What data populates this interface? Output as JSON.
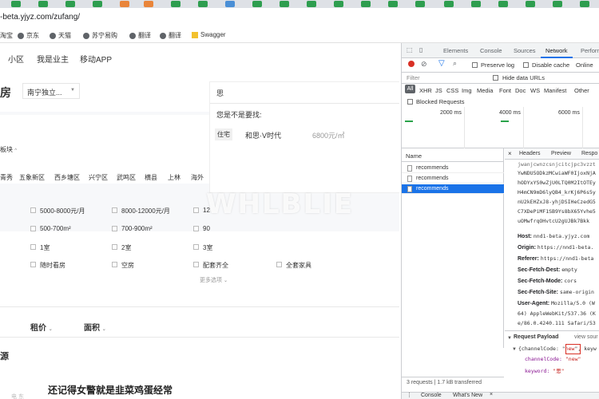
{
  "browser": {
    "url": "-beta.yjyz.com/zufang/",
    "bookmarks": [
      "京东",
      "天猫",
      "苏宁易购",
      "翻译",
      "翻译",
      "Swagger"
    ],
    "bookmark_partial": "淘宝"
  },
  "page": {
    "nav": [
      "小区",
      "我是业主",
      "移动APP"
    ],
    "logo_char": "房",
    "city_select": "南宁独立...",
    "search_value": "思",
    "suggest_title": "您是不是要找:",
    "suggest_tag": "住宅",
    "suggest_name": "和思·V时代",
    "suggest_price": "6800元/㎡",
    "filter_label": "板块",
    "districts": [
      "青秀",
      "五象新区",
      "西乡塘区",
      "兴宁区",
      "武鸣区",
      "横县",
      "上林",
      "海外"
    ],
    "rent_options": [
      "5000-8000元/月",
      "8000-12000元/月",
      "12"
    ],
    "area_options": [
      "500-700m²",
      "700-900m²",
      "90"
    ],
    "room_options": [
      "1室",
      "2室",
      "3室"
    ],
    "feature_options": [
      "随时看房",
      "空房",
      "配套齐全",
      "全套家具"
    ],
    "more_filters": "更多选项",
    "sort_price": "租价",
    "sort_area": "面积",
    "section_title": "源",
    "listing_title": "还记得女警就是韭菜鸡蛋经常",
    "listing_sub": "电 东"
  },
  "devtools": {
    "tabs": [
      "Elements",
      "Console",
      "Sources",
      "Network",
      "Performa"
    ],
    "active_tab": "Network",
    "preserve_log": "Preserve log",
    "disable_cache": "Disable cache",
    "online": "Online",
    "filter_placeholder": "Filter",
    "hide_data_urls": "Hide data URLs",
    "type_filters": [
      "All",
      "XHR",
      "JS",
      "CSS",
      "Img",
      "Media",
      "Font",
      "Doc",
      "WS",
      "Manifest",
      "Other"
    ],
    "blocked_requests": "Blocked Requests",
    "timeline_labels": [
      "2000 ms",
      "4000 ms",
      "6000 ms"
    ],
    "name_header": "Name",
    "requests": [
      "recommends",
      "recommends",
      "recommends"
    ],
    "detail_tabs": [
      "Headers",
      "Preview",
      "Respo"
    ],
    "token_lines": [
      "jwanjcwnzcsnjcitcjpc3vzzt",
      "YwNDU5ODkzMCwiaWF0IjoxNjA",
      "hODYxYS0wZjU0LTQ0M2ItOTEy",
      "H4mCN9mD6lyQB4_krKj6P6s5y",
      "nU2kEHZxJ8-yhjDSIHeCzedG5",
      "C7XDePiMF1SB9Ys8bX65Yvhe5",
      "uOMwfrqOHvtcU2gUJBk7Bkk"
    ],
    "headers": [
      {
        "key": "Host:",
        "value": "nnd1-beta.yjyz.com"
      },
      {
        "key": "Origin:",
        "value": "https://nnd1-beta."
      },
      {
        "key": "Referer:",
        "value": "https://nnd1-beta"
      },
      {
        "key": "Sec-Fetch-Dest:",
        "value": "empty"
      },
      {
        "key": "Sec-Fetch-Mode:",
        "value": "cors"
      },
      {
        "key": "Sec-Fetch-Site:",
        "value": "same-origin"
      },
      {
        "key": "User-Agent:",
        "value": "Mozilla/5.0 (W"
      }
    ],
    "ua_cont_1": "64) AppleWebKit/537.36 (K",
    "ua_cont_2": "e/86.0.4240.111 Safari/53",
    "payload_title": "Request Payload",
    "view_source": "view sour",
    "payload_summary_prefix": "{channelCode: \"",
    "payload_summary_value": "new",
    "payload_summary_suffix": "\", keyw",
    "payload_channel_key": "channelCode:",
    "payload_channel_value": "\"new\"",
    "payload_keyword_key": "keyword:",
    "payload_keyword_value": "\"思\"",
    "status": "3 requests | 1.7 kB transferred",
    "drawer_tabs": [
      "Console",
      "What's New"
    ]
  },
  "watermark": "WHLBLIE",
  "colors": {
    "accent_green": "#2aa34a",
    "devtools_blue": "#1a73e8",
    "record_red": "#d93025"
  }
}
